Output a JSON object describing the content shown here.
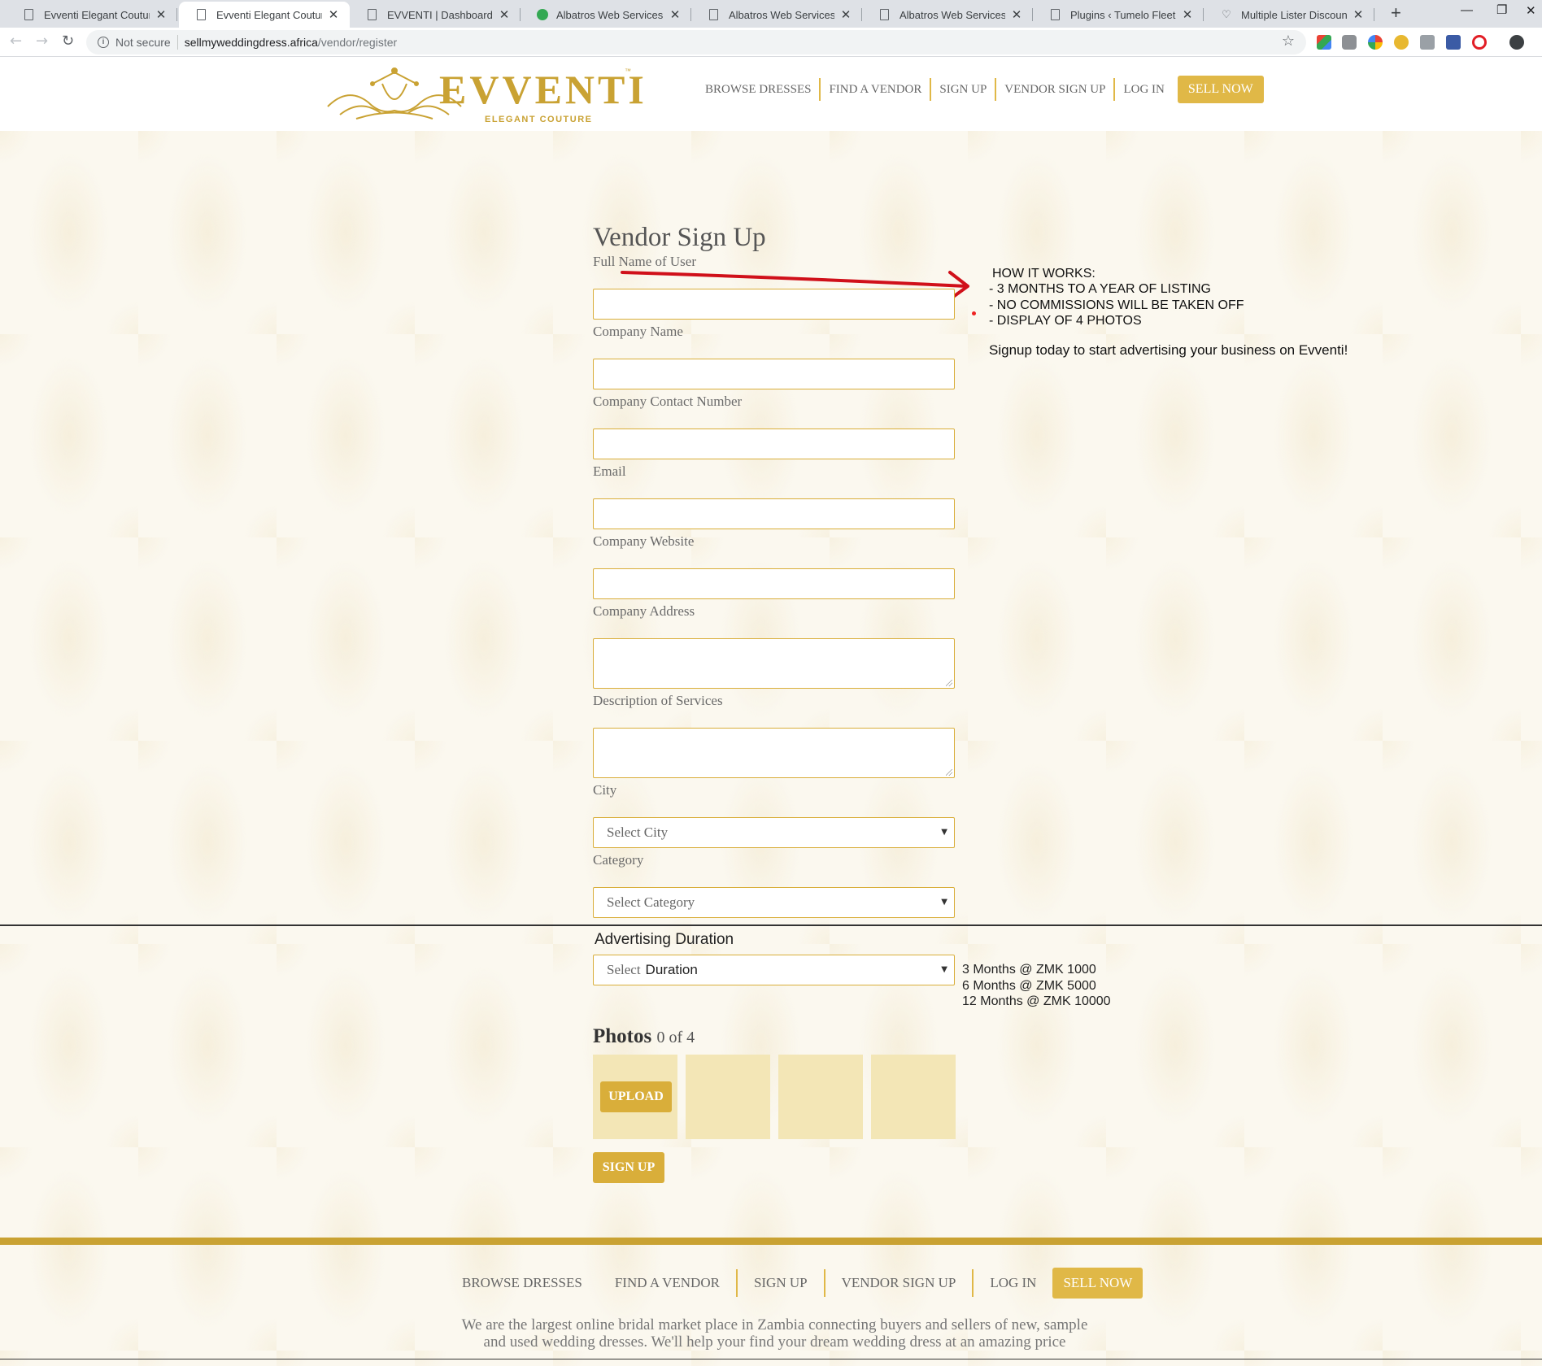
{
  "browser": {
    "tabs": [
      {
        "title": "Evventi Elegant Couture",
        "icon": "page-icon"
      },
      {
        "title": "Evventi Elegant Couture",
        "icon": "page-icon",
        "active": true
      },
      {
        "title": "EVVENTI | Dashboard",
        "icon": "page-icon"
      },
      {
        "title": "Albatros Web Services",
        "icon": "green-circle-icon"
      },
      {
        "title": "Albatros Web Services",
        "icon": "page-icon"
      },
      {
        "title": "Albatros Web Services",
        "icon": "page-icon"
      },
      {
        "title": "Plugins ‹ Tumelo Fleet Solu",
        "icon": "page-icon"
      },
      {
        "title": "Multiple Lister Discount - S",
        "icon": "heart-icon"
      }
    ],
    "address": {
      "security": "Not secure",
      "host": "sellmyweddingdress.africa",
      "path": "/vendor/register"
    }
  },
  "header": {
    "logo_word": "EVVENTI",
    "logo_tm": "™",
    "logo_sub": "ELEGANT COUTURE",
    "nav": [
      "BROWSE DRESSES",
      "FIND A VENDOR",
      "SIGN UP",
      "VENDOR SIGN UP",
      "LOG IN"
    ],
    "sell_now": "SELL NOW",
    "accent": "#e0b847"
  },
  "form": {
    "title": "Vendor Sign Up",
    "fields": {
      "full_name": {
        "label": "Full Name of User",
        "value": ""
      },
      "company_name": {
        "label": "Company Name",
        "value": ""
      },
      "contact_number": {
        "label": "Company Contact Number",
        "value": ""
      },
      "email": {
        "label": "Email",
        "value": ""
      },
      "website": {
        "label": "Company Website",
        "value": ""
      },
      "address": {
        "label": "Company Address",
        "value": ""
      },
      "description": {
        "label": "Description of Services",
        "value": ""
      }
    },
    "city": {
      "label": "City",
      "selected": "Select City"
    },
    "category": {
      "label": "Category",
      "selected": "Select Category"
    },
    "duration": {
      "label": "Advertising Duration",
      "selected_a": "Select",
      "selected_b": "Duration"
    },
    "prices": [
      "3 Months @ ZMK 1000",
      "6 Months @ ZMK 5000",
      "12 Months @ ZMK 10000"
    ],
    "photos": {
      "title": "Photos",
      "count": "0 of 4",
      "upload": "UPLOAD",
      "slots": 4
    },
    "submit": "SIGN UP"
  },
  "how_it_works": {
    "heading": "HOW IT WORKS:",
    "items": [
      "- 3 MONTHS TO A YEAR OF LISTING",
      "- NO COMMISSIONS WILL BE TAKEN OFF",
      "- DISPLAY OF 4 PHOTOS"
    ],
    "cta": "Signup today to start advertising your business on Evventi!"
  },
  "footer": {
    "nav": [
      "BROWSE DRESSES",
      "FIND A VENDOR",
      "SIGN UP",
      "VENDOR SIGN UP",
      "LOG IN"
    ],
    "sell_now": "SELL NOW",
    "text": "We are the largest online bridal market place in Zambia connecting buyers and sellers of new, sample and used wedding dresses. We'll help your find your dream wedding dress at an amazing price",
    "band_color": "#c9a233"
  }
}
